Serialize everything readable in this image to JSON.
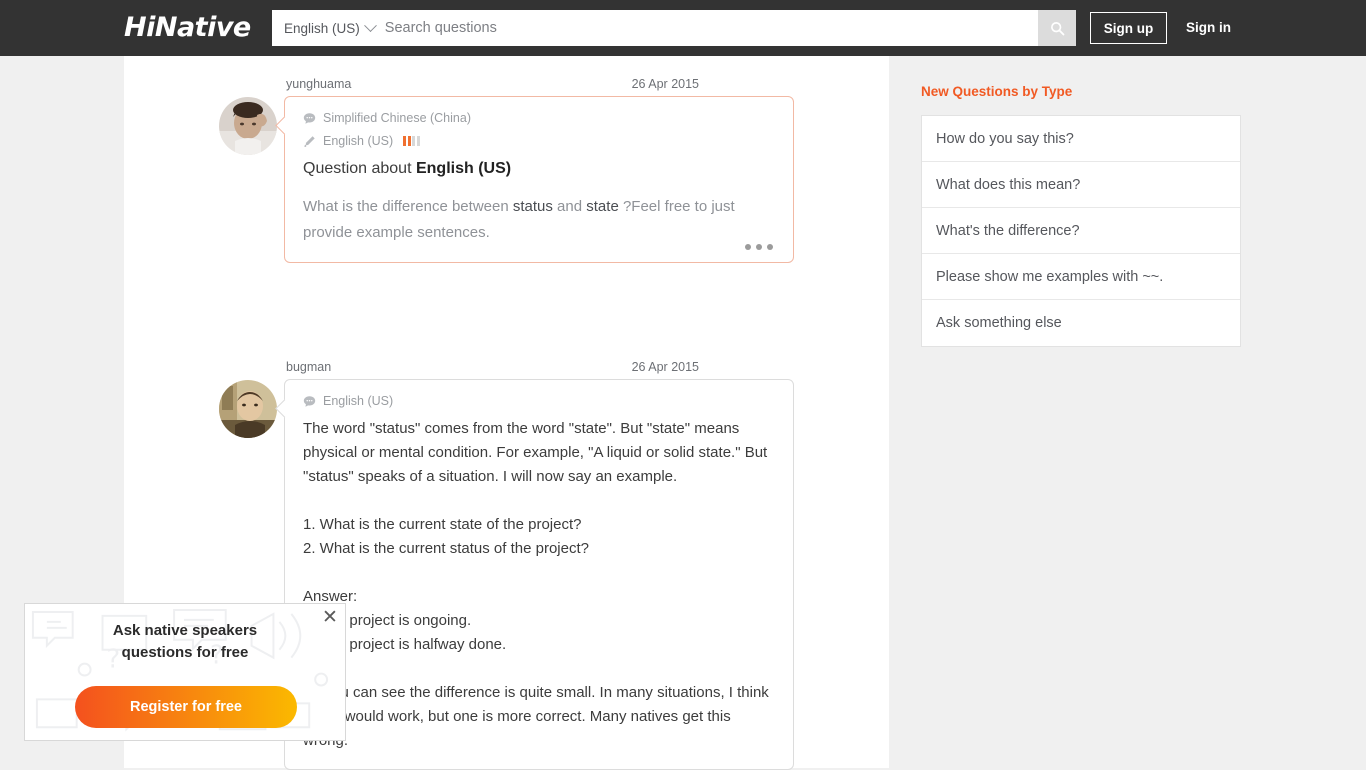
{
  "header": {
    "logo": "HiNative",
    "language_selector": "English (US)",
    "search_placeholder": "Search questions",
    "search_value": "",
    "search_icon": "search-icon",
    "sign_up": "Sign up",
    "sign_in": "Sign in",
    "background_color": "#333333"
  },
  "question": {
    "username": "yunghuama",
    "date": "26 Apr 2015",
    "speaks_language": "Simplified Chinese (China)",
    "learning_language": "English (US)",
    "proficiency_filled": 2,
    "proficiency_total": 4,
    "title_prefix": "Question about ",
    "title_language": "English (US)",
    "body_part1": "What is the difference between ",
    "body_term1": "status",
    "body_part2": " and ",
    "body_term2": "state",
    "body_part3": " ?Feel free to just provide example sentences.",
    "menu_icon": "more-options-icon",
    "border_color": "#f2b9a4"
  },
  "answer": {
    "username": "bugman",
    "date": "26 Apr 2015",
    "language": "English (US)",
    "body": "The word \"status\" comes from the word \"state\". But \"state\" means physical or mental condition. For example, \"A liquid or solid state.\" But \"status\" speaks of a situation. I will now say an example.\n\n1. What is the current state of the project?\n2. What is the current status of the project?\n\nAnswer:\n1. The project is ongoing.\n2. The project is halfway done.\n\nAs you can see the difference is quite small. In many situations, I think either would work, but one is more correct. Many natives get this wrong.",
    "border_color": "#dcdcdc"
  },
  "sidebar": {
    "title": "New Questions by Type",
    "title_color": "#f15a24",
    "items": [
      {
        "label": "How do you say this?"
      },
      {
        "label": "What does this mean?"
      },
      {
        "label": "What's the difference?"
      },
      {
        "label": "Please show me examples with ~~."
      },
      {
        "label": "Ask something else"
      }
    ]
  },
  "popup": {
    "title_line1": "Ask native speakers",
    "title_line2": "questions for free",
    "button_label": "Register for free",
    "close_icon": "close-icon",
    "button_gradient_start": "#f4511e",
    "button_gradient_end": "#fbb900"
  }
}
